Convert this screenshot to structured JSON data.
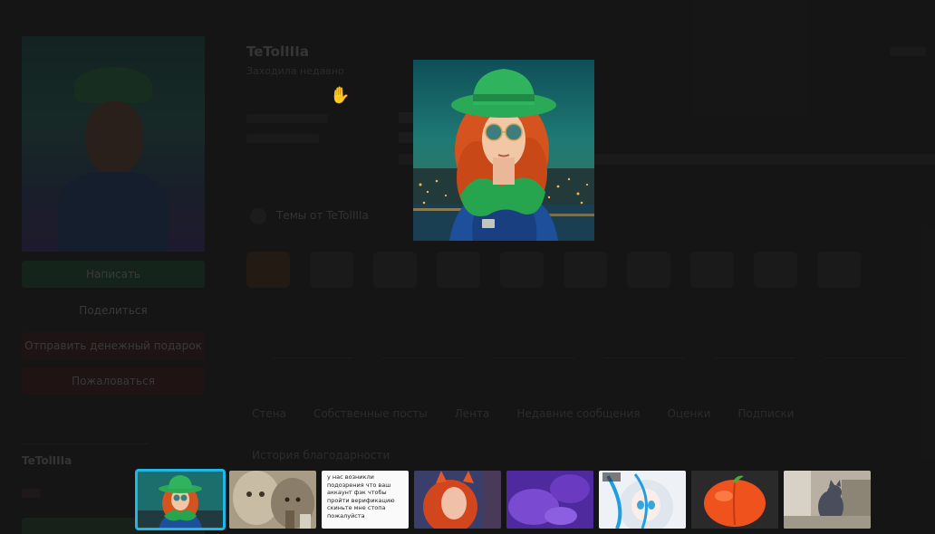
{
  "background": {
    "profile_name": "TeTolIIIa",
    "profile_subtitle": "Заходила недавно",
    "sidebar": {
      "buttons": [
        {
          "label": "Написать",
          "style": "green"
        },
        {
          "label": "Поделиться",
          "style": "plain"
        },
        {
          "label": "Отправить денежный подарок",
          "style": "red"
        },
        {
          "label": "Пожаловаться",
          "style": "red"
        }
      ],
      "username": "TeTolIIIa"
    },
    "theme_label": "Темы от TeTolIIIa",
    "tabs": [
      "Стена",
      "Собственные посты",
      "Лента",
      "Недавние сообщения",
      "Оценки",
      "Подписки"
    ],
    "history_label": "История благодарности"
  },
  "lightbox": {
    "main_image": "woman-green-hat-red-hair-photo",
    "thumbnails": [
      {
        "kind": "photo",
        "icon": "woman-green-hat-photo",
        "active": true
      },
      {
        "kind": "photo",
        "icon": "cats-photo",
        "active": false
      },
      {
        "kind": "text",
        "icon": "text-screenshot",
        "active": false,
        "text": "у нас возникли подозрения что ваш аккаунт фэк чтобы пройти верификацию скиньте мне стопа пожалуйста"
      },
      {
        "kind": "photo",
        "icon": "red-haired-cosplayer-photo",
        "active": false
      },
      {
        "kind": "photo",
        "icon": "purple-blurred-photo",
        "active": false
      },
      {
        "kind": "photo",
        "icon": "anime-girl-drawing",
        "active": false
      },
      {
        "kind": "photo",
        "icon": "peach-image",
        "active": false
      },
      {
        "kind": "photo",
        "icon": "cat-in-room-photo",
        "active": false
      }
    ]
  }
}
